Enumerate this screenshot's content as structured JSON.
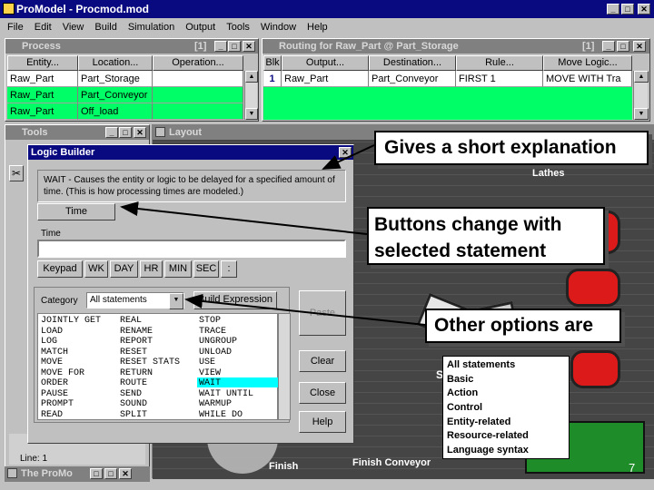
{
  "app": {
    "title": "ProModel - Procmod.mod"
  },
  "menu": [
    "File",
    "Edit",
    "View",
    "Build",
    "Simulation",
    "Output",
    "Tools",
    "Window",
    "Help"
  ],
  "process": {
    "title": "Process",
    "count": "[1]",
    "headers": [
      "Entity...",
      "Location...",
      "Operation..."
    ],
    "rows": [
      [
        "Raw_Part",
        "Part_Storage",
        ""
      ],
      [
        "Raw_Part",
        "Part_Conveyor",
        ""
      ],
      [
        "Raw_Part",
        "Off_load",
        ""
      ]
    ]
  },
  "routing": {
    "title": "Routing for Raw_Part @ Part_Storage",
    "count": "[1]",
    "headers": [
      "Blk",
      "Output...",
      "Destination...",
      "Rule...",
      "Move Logic..."
    ],
    "rows": [
      [
        "1",
        "Raw_Part",
        "Part_Conveyor",
        "FIRST 1",
        "MOVE WITH Tra"
      ]
    ]
  },
  "tools": {
    "title": "Tools"
  },
  "layout": {
    "title": "Layout",
    "labels": {
      "lathes": "Lathes",
      "finish": "Finish",
      "finish_conveyor": "Finish Conveyor",
      "s": "S",
      "seven": "7"
    }
  },
  "logic_builder": {
    "title": "Logic Builder",
    "description": "WAIT - Causes the entity or logic to be delayed for a specified amount of time.  (This is how processing times are modeled.)",
    "param_button": "Time",
    "time_label": "Time",
    "time_value": "",
    "unit_buttons": [
      "Keypad",
      "WK",
      "DAY",
      "HR",
      "MIN",
      "SEC",
      ":"
    ],
    "category_label": "Category",
    "category_value": "All statements",
    "build_expression": "Build Expression",
    "paste": "Paste",
    "clear": "Clear",
    "close": "Close",
    "help": "Help",
    "statements": [
      [
        "JOINTLY GET",
        "LOAD",
        "LOG",
        "MATCH",
        "MOVE",
        "MOVE FOR",
        "ORDER",
        "PAUSE",
        "PROMPT",
        "READ"
      ],
      [
        "REAL",
        "RENAME",
        "REPORT",
        "RESET",
        "RESET STATS",
        "RETURN",
        "ROUTE",
        "SEND",
        "SOUND",
        "SPLIT"
      ],
      [
        "STOP",
        "TRACE",
        "UNGROUP",
        "UNLOAD",
        "USE",
        "VIEW",
        "WAIT",
        "WAIT UNTIL",
        "WARMUP",
        "WHILE DO"
      ]
    ],
    "selected": "WAIT"
  },
  "line_status": "Line: 1",
  "taskbar": {
    "label": "The ProMo"
  },
  "category_options": [
    "All statements",
    "Basic",
    "Action",
    "Control",
    "Entity-related",
    "Resource-related",
    "Language syntax"
  ],
  "callouts": {
    "explanation": "Gives a short explanation",
    "buttons": "Buttons change with selected statement",
    "options": "Other options are"
  },
  "colors": {
    "titlebar": "#0a0a80",
    "grid_highlight": "#00ff66",
    "selection": "#00ffff",
    "machine": "#dd1a1a"
  }
}
